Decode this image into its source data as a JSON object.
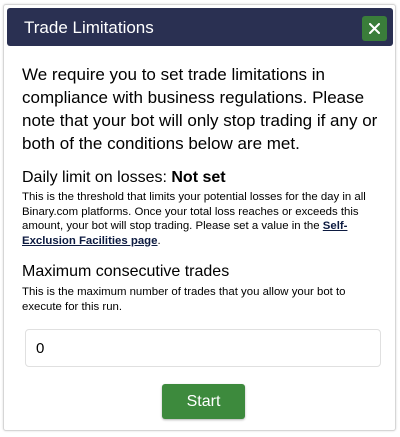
{
  "dialog": {
    "title": "Trade Limitations",
    "close_icon": "close-icon",
    "intro": "We require you to set trade limitations in compliance with business regulations. Please note that your bot will only stop trading if any or both of the conditions below are met."
  },
  "daily_limit": {
    "label": "Daily limit on losses: ",
    "value": "Not set",
    "description_before": "This is the threshold that limits your potential losses for the day in all Binary.com platforms. Once your total loss reaches or exceeds this amount, your bot will stop trading. Please set a value in the ",
    "link_text": "Self-Exclusion Facilities page",
    "description_after": "."
  },
  "max_trades": {
    "label": "Maximum consecutive trades",
    "description": "This is the maximum number of trades that you allow your bot to execute for this run.",
    "value": "0"
  },
  "actions": {
    "start_label": "Start"
  },
  "colors": {
    "titlebar": "#2a3052",
    "close_button": "#3a7d3a",
    "start_button": "#3d8a3d"
  }
}
